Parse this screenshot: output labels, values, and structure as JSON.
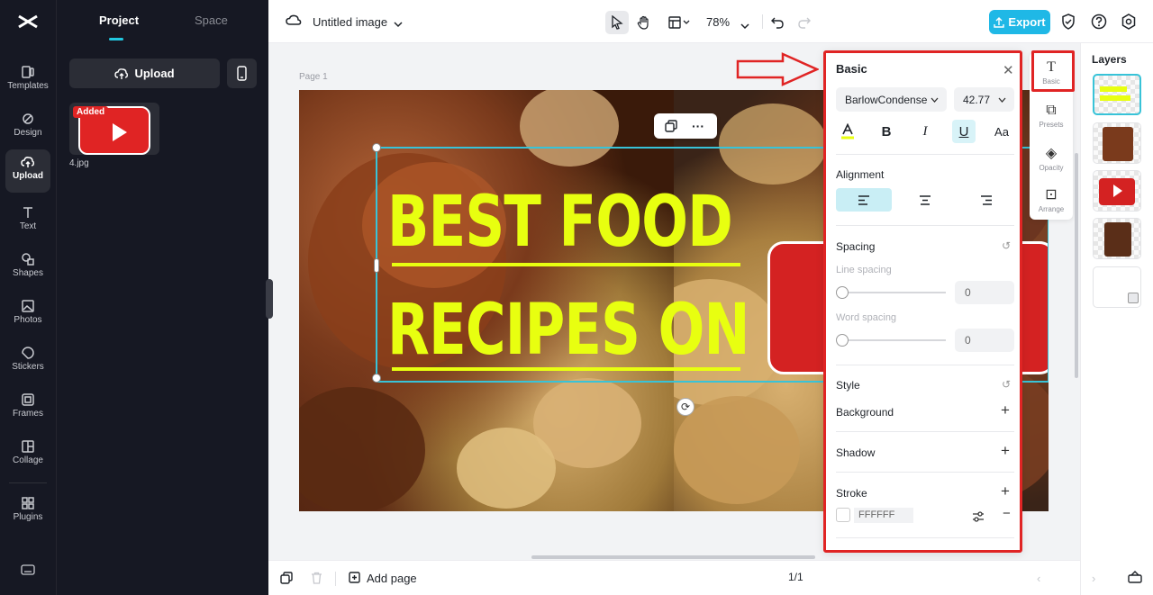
{
  "rail": {
    "items": [
      {
        "label": "Templates",
        "icon": "templates-icon"
      },
      {
        "label": "Design",
        "icon": "design-icon"
      },
      {
        "label": "Upload",
        "icon": "upload-icon",
        "active": true
      },
      {
        "label": "Text",
        "icon": "text-icon"
      },
      {
        "label": "Shapes",
        "icon": "shapes-icon"
      },
      {
        "label": "Photos",
        "icon": "photos-icon"
      },
      {
        "label": "Stickers",
        "icon": "stickers-icon"
      },
      {
        "label": "Frames",
        "icon": "frames-icon"
      },
      {
        "label": "Collage",
        "icon": "collage-icon"
      },
      {
        "label": "Plugins",
        "icon": "plugins-icon"
      }
    ]
  },
  "panel": {
    "tab_project": "Project",
    "tab_space": "Space",
    "upload_label": "Upload",
    "thumb_badge": "Added",
    "thumb_name": "4.jpg"
  },
  "topbar": {
    "title": "Untitled image",
    "zoom": "78%",
    "export_label": "Export"
  },
  "canvas": {
    "page_label": "Page 1",
    "headline_1": "BEST FOOD",
    "headline_2": "RECIPES ON"
  },
  "basic": {
    "title": "Basic",
    "font_family": "BarlowCondense",
    "font_size": "42.77",
    "alignment_label": "Alignment",
    "spacing_label": "Spacing",
    "line_spacing_label": "Line spacing",
    "line_spacing_value": "0",
    "word_spacing_label": "Word spacing",
    "word_spacing_value": "0",
    "style_label": "Style",
    "background_label": "Background",
    "shadow_label": "Shadow",
    "stroke_label": "Stroke",
    "stroke_color": "FFFFFF"
  },
  "minibar": {
    "basic": "Basic",
    "presets": "Presets",
    "opacity": "Opacity",
    "arrange": "Arrange"
  },
  "layers": {
    "title": "Layers"
  },
  "bottombar": {
    "add_page": "Add page",
    "pager": "1/1"
  },
  "colors": {
    "accent": "#1fb8e6",
    "headline": "#e8ff10",
    "highlight_border": "#e02424",
    "youtube_red": "#d42222"
  }
}
